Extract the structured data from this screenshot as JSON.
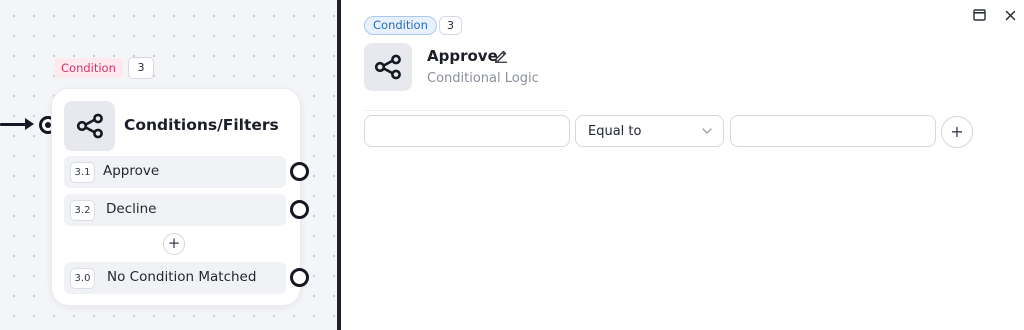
{
  "canvas": {
    "node": {
      "tag": "Condition",
      "count": "3",
      "icon": "share-nodes-icon",
      "title": "Conditions/Filters",
      "conditions": [
        {
          "num": "3.1",
          "label": "Approve"
        },
        {
          "num": "3.2",
          "label": "Decline"
        },
        {
          "num": "3.0",
          "label": "No Condition Matched"
        }
      ],
      "add_label": "+"
    }
  },
  "panel": {
    "tag": "Condition",
    "count": "3",
    "icon": "share-nodes-icon",
    "title": "Approve",
    "subtitle": "Conditional Logic",
    "rule": {
      "left_value": "",
      "operator": "Equal to",
      "right_value": ""
    },
    "add_label": "+",
    "window_icons": [
      "expand-window-icon",
      "close-icon"
    ]
  },
  "colors": {
    "canvas_bg": "#f4f5f8",
    "condition_tag_bg": "#fde9ee",
    "condition_tag_text": "#d0356a",
    "panel_tag_bg": "#e7f1fc",
    "panel_tag_text": "#2b6cb8",
    "port": "#151722",
    "divider": "#1e2029"
  }
}
